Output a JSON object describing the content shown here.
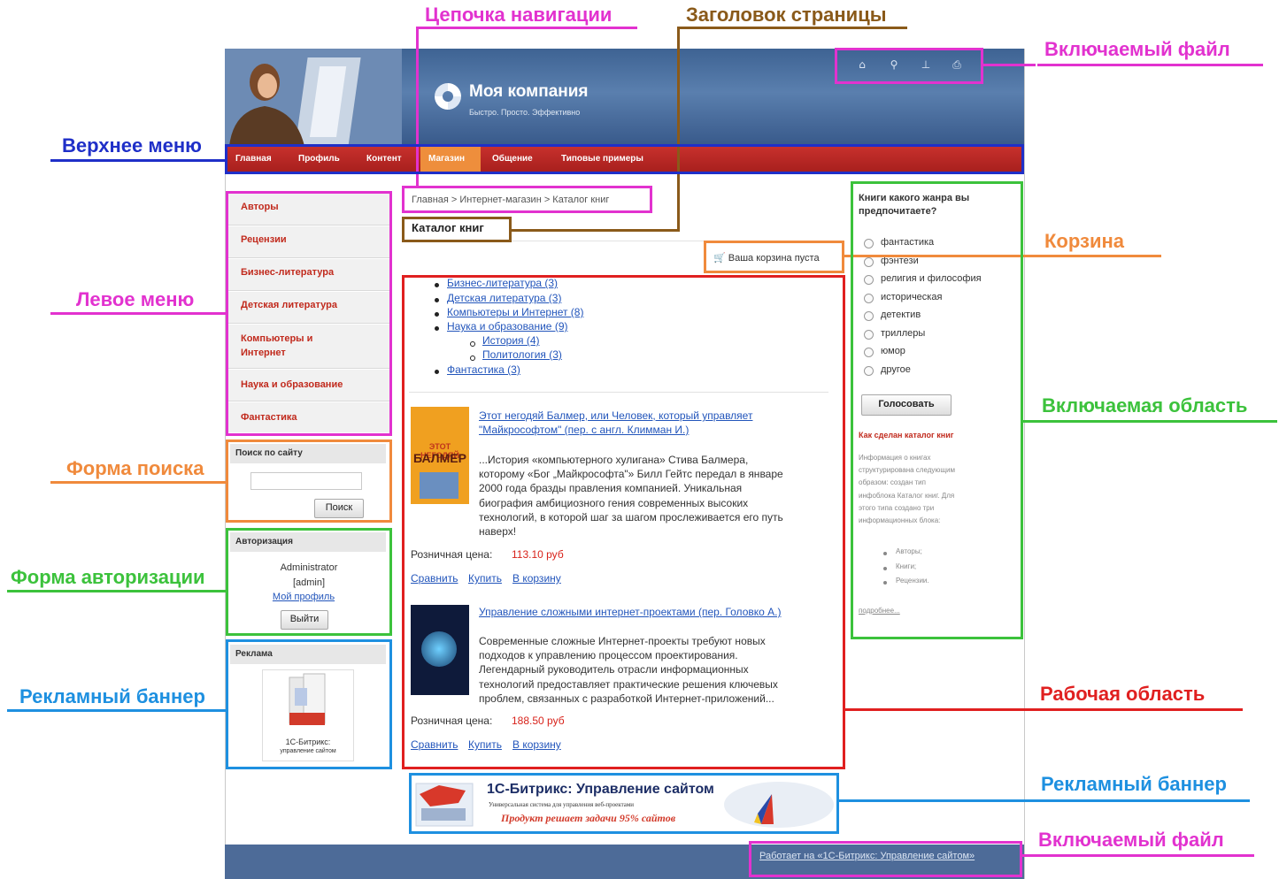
{
  "colors": {
    "blue": "#1f2fc8",
    "magenta": "#e232cf",
    "brown": "#8a5a1a",
    "orange": "#f08a3c",
    "green": "#3cc23c",
    "red": "#e02020",
    "sky": "#1e90e0"
  },
  "site": {
    "logo_title": "Моя компания",
    "logo_slogan": "Быстро. Просто. Эффективно",
    "header_icons": [
      "home-icon",
      "search-icon",
      "sitemap-icon",
      "print-icon"
    ],
    "top_menu": [
      "Главная",
      "Профиль",
      "Контент",
      "Магазин",
      "Общение",
      "Типовые примеры"
    ],
    "top_menu_active": "Магазин",
    "left_menu": [
      "Авторы",
      "Рецензии",
      "Бизнес-литература",
      "Детская литература",
      "Компьютеры и Интернет",
      "Наука и образование",
      "Фантастика"
    ],
    "search": {
      "title": "Поиск по сайту",
      "button": "Поиск"
    },
    "auth": {
      "title": "Авторизация",
      "user": "Administrator",
      "login": "[admin]",
      "profile": "Мой профиль",
      "logout": "Выйти"
    },
    "ad": {
      "title": "Реклама",
      "caption1": "1С-Битрикс:",
      "caption2": "управление сайтом"
    },
    "breadcrumb": "Главная > Интернет-магазин > Каталог книг",
    "page_title": "Каталог книг",
    "cart": "Ваша корзина пуста",
    "categories": [
      {
        "text": "Бизнес-литература (3)"
      },
      {
        "text": "Детская литература (3)"
      },
      {
        "text": "Компьютеры и Интернет (8)"
      },
      {
        "text": "Наука и образование (9)"
      },
      {
        "text": "История (4)"
      },
      {
        "text": "Политология (3)"
      },
      {
        "text": "Фантастика (3)"
      }
    ],
    "books": [
      {
        "title": [
          "Этот негодяй Балмер, или Человек, который управляет",
          "\"Майкрософтом\" (пер. с англ. Климман И.)"
        ],
        "cover_text": [
          "ЭТОТ НЕГОДЯЙ",
          "БАЛМЕР"
        ],
        "desc": [
          "...История «компьютерного хулигана» Стива Балмера,",
          "которому «Бог „Майкрософта\"» Билл Гейтс передал в январе",
          "2000 года бразды правления компанией. Уникальная",
          "биография амбициозного гения современных высоких",
          "технологий, в которой шаг за шагом прослеживается его путь",
          "наверх!"
        ],
        "price_label": "Розничная цена:",
        "price": "113.10 руб",
        "links": [
          "Сравнить",
          "Купить",
          "В корзину"
        ]
      },
      {
        "title": [
          "Управление сложными интернет-проектами (пер. Головко А.)"
        ],
        "desc": [
          "Современные сложные Интернет-проекты требуют новых",
          "подходов к управлению процессом проектирования.",
          "Легендарный руководитель отрасли информационных",
          "технологий предоставляет практические решения ключевых",
          "проблем, связанных с разработкой Интернет-приложений..."
        ],
        "price_label": "Розничная цена:",
        "price": "188.50 руб",
        "links": [
          "Сравнить",
          "Купить",
          "В корзину"
        ]
      }
    ],
    "poll": {
      "question": [
        "Книги какого жанра вы",
        "предпочитаете?"
      ],
      "options": [
        "фантастика",
        "фэнтези",
        "религия и философия",
        "историческая",
        "детектив",
        "триллеры",
        "юмор",
        "другое"
      ],
      "button": "Голосовать"
    },
    "info": {
      "title": "Как сделан каталог книг",
      "text": [
        "Информация о книгах",
        "структурирована следующим",
        "образом: создан тип",
        "инфоблока Каталог книг. Для",
        "этого типа создано три",
        "информационных блока:"
      ],
      "items": [
        "Авторы;",
        "Книги;",
        "Рецензии."
      ],
      "more": "подробнее..."
    },
    "banner": {
      "title": "1С-Битрикс: Управление сайтом",
      "sub": "Универсальная система для управления веб-проектами",
      "slogan": "Продукт решает задачи 95% сайтов"
    },
    "footer": "Работает на «1С-Битрикс: Управление сайтом»"
  },
  "labels": {
    "breadcrumb": "Цепочка навигации",
    "page_title": "Заголовок страницы",
    "include_top": "Включаемый файл",
    "top_menu": "Верхнее меню",
    "left_menu": "Левое меню",
    "cart": "Корзина",
    "search": "Форма поиска",
    "include_area": "Включаемая область",
    "auth": "Форма авторизации",
    "ad_left": "Рекламный баннер",
    "work": "Рабочая область",
    "ad_bottom": "Рекламный баннер",
    "include_bottom": "Включаемый файл"
  }
}
